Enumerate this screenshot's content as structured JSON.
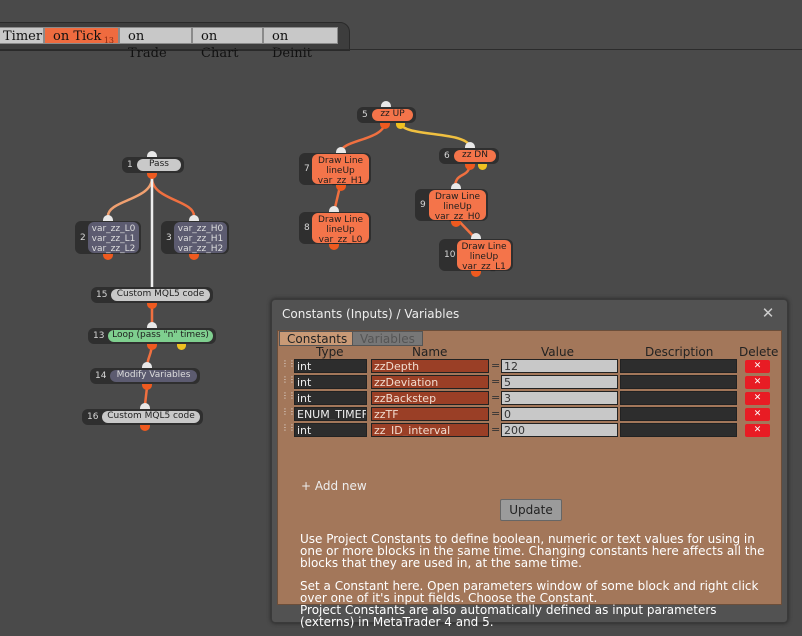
{
  "tabs": [
    {
      "label": "Timer",
      "active": false
    },
    {
      "label": "on Tick",
      "active": true,
      "badge": "13"
    },
    {
      "label": "on Trade",
      "active": false
    },
    {
      "label": "on Chart",
      "active": false
    },
    {
      "label": "on Deinit",
      "active": false
    }
  ],
  "nodes": {
    "n1": {
      "num": "1",
      "label": "Pass"
    },
    "n2": {
      "num": "2",
      "lines": [
        "var_zz_L0",
        "var_zz_L1",
        "var_zz_L2"
      ]
    },
    "n3": {
      "num": "3",
      "lines": [
        "var_zz_H0",
        "var_zz_H1",
        "var_zz_H2"
      ]
    },
    "n15": {
      "num": "15",
      "label": "Custom MQL5 code"
    },
    "n13": {
      "num": "13",
      "label": "Loop (pass \"n\" times)"
    },
    "n14": {
      "num": "14",
      "label": "Modify Variables"
    },
    "n16": {
      "num": "16",
      "label": "Custom MQL5 code"
    },
    "n5": {
      "num": "5",
      "label": "zz UP"
    },
    "n6": {
      "num": "6",
      "label": "zz DN"
    },
    "n7": {
      "num": "7",
      "lines": [
        "Draw Line",
        "lineUp",
        "var_zz_H1"
      ]
    },
    "n8": {
      "num": "8",
      "lines": [
        "Draw Line",
        "lineUp",
        "var_zz_L0"
      ]
    },
    "n9": {
      "num": "9",
      "lines": [
        "Draw Line",
        "lineUp",
        "var_zz_H0"
      ]
    },
    "n10": {
      "num": "10",
      "lines": [
        "Draw Line",
        "lineUp",
        "var_zz_L1"
      ]
    }
  },
  "dialog": {
    "title": "Constants (Inputs) / Variables",
    "close": "✕",
    "tabs": {
      "constants": "Constants",
      "variables": "Variables"
    },
    "headers": {
      "type": "Type",
      "name": "Name",
      "value": "Value",
      "description": "Description",
      "delete": "Delete"
    },
    "rows": [
      {
        "type": "int",
        "name": "zzDepth",
        "value": "12",
        "description": ""
      },
      {
        "type": "int",
        "name": "zzDeviation",
        "value": "5",
        "description": ""
      },
      {
        "type": "int",
        "name": "zzBackstep",
        "value": "3",
        "description": ""
      },
      {
        "type": "ENUM_TIMEF",
        "name": "zzTF",
        "value": "0",
        "description": ""
      },
      {
        "type": "int",
        "name": "zz_ID_interval",
        "value": "200",
        "description": ""
      }
    ],
    "eq": "=",
    "delete_glyph": "✕",
    "add_new": "+ Add new",
    "update": "Update",
    "help": [
      "Use Project Constants to define boolean, numeric or text values for using in one or more blocks in the same time. Changing constants here affects all the blocks that they are used in, at the same time.",
      "Set a Constant here. Open parameters window of some block and right click over one of it's input fields. Choose the Constant.",
      "Project Constants are also automatically defined as input parameters (externs) in MetaTrader 4 and 5."
    ]
  }
}
